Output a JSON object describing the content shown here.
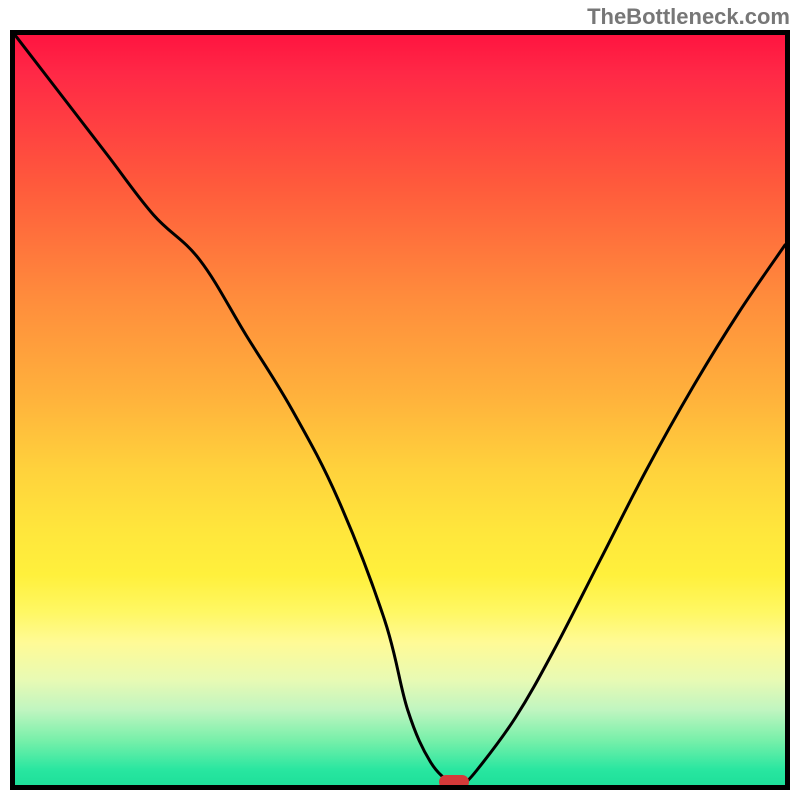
{
  "watermark": "TheBottleneck.com",
  "chart_data": {
    "type": "line",
    "title": "",
    "xlabel": "",
    "ylabel": "",
    "xlim": [
      0,
      100
    ],
    "ylim": [
      0,
      100
    ],
    "series": [
      {
        "name": "bottleneck-curve",
        "x": [
          0,
          6,
          12,
          18,
          24,
          30,
          36,
          42,
          48,
          51,
          54,
          57,
          58,
          60,
          65,
          70,
          76,
          82,
          88,
          94,
          100
        ],
        "values": [
          100,
          92,
          84,
          76,
          70,
          60,
          50,
          38,
          22,
          10,
          3,
          0,
          0,
          2,
          9,
          18,
          30,
          42,
          53,
          63,
          72
        ]
      }
    ],
    "marker": {
      "x": 57,
      "y": 0
    },
    "background_gradient": {
      "stops": [
        {
          "pos": 0,
          "color": "#ff1440"
        },
        {
          "pos": 5,
          "color": "#ff2846"
        },
        {
          "pos": 20,
          "color": "#ff5a3c"
        },
        {
          "pos": 35,
          "color": "#ff8c3c"
        },
        {
          "pos": 48,
          "color": "#ffb13c"
        },
        {
          "pos": 58,
          "color": "#ffd23c"
        },
        {
          "pos": 66,
          "color": "#ffe63c"
        },
        {
          "pos": 72,
          "color": "#fff03c"
        },
        {
          "pos": 77,
          "color": "#fff864"
        },
        {
          "pos": 81,
          "color": "#fffa96"
        },
        {
          "pos": 86,
          "color": "#e8fab4"
        },
        {
          "pos": 90,
          "color": "#c0f5c0"
        },
        {
          "pos": 94,
          "color": "#78f0aa"
        },
        {
          "pos": 98,
          "color": "#28e6a0"
        },
        {
          "pos": 100,
          "color": "#1ee09a"
        }
      ]
    }
  }
}
